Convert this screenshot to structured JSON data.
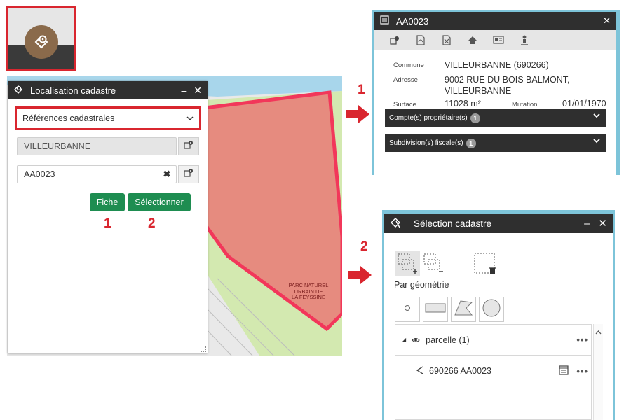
{
  "colors": {
    "accent_red": "#d9262f",
    "button_green": "#1e8d51",
    "header_dark": "#2f2f2f",
    "map_zone": "#e68b7f",
    "map_green": "#d3e9b0",
    "map_water": "#a8d6eb"
  },
  "launcher": {
    "icon": "map-marker-parcel-icon"
  },
  "map": {
    "label": "PARC NATUREL\nURBAIN DE\nLA FEYSSINE"
  },
  "localisation_panel": {
    "title": "Localisation cadastre",
    "minimize": "–",
    "close": "✕",
    "select_value": "Références cadastrales",
    "commune_value": "VILLEURBANNE",
    "parcel_value": "AA0023",
    "clear": "✖",
    "button_fiche": "Fiche",
    "button_select": "Sélectionner",
    "step_fiche": "1",
    "step_select": "2"
  },
  "step_labels": {
    "fiche": "1",
    "selection": "2"
  },
  "fiche_panel": {
    "title": "AA0023",
    "minimize": "–",
    "close": "✕",
    "commune_label": "Commune",
    "commune_value": "VILLEURBANNE (690266)",
    "adresse_label": "Adresse",
    "adresse_line1": "9002 RUE DU BOIS BALMONT,",
    "adresse_line2": "VILLEURBANNE",
    "surface_label": "Surface",
    "surface_value": "11028 m²",
    "mutation_label": "Mutation",
    "mutation_value": "01/01/1970",
    "accordion1": "Compte(s) propriétaire(s)",
    "accordion1_count": "1",
    "accordion2": "Subdivision(s) fiscale(s)",
    "accordion2_count": "1"
  },
  "selection_panel": {
    "title": "Sélection cadastre",
    "minimize": "–",
    "close": "✕",
    "geometry_label": "Par géométrie",
    "layer_name": "parcelle (1)",
    "item_name": "690266 AA0023",
    "more": "•••"
  }
}
